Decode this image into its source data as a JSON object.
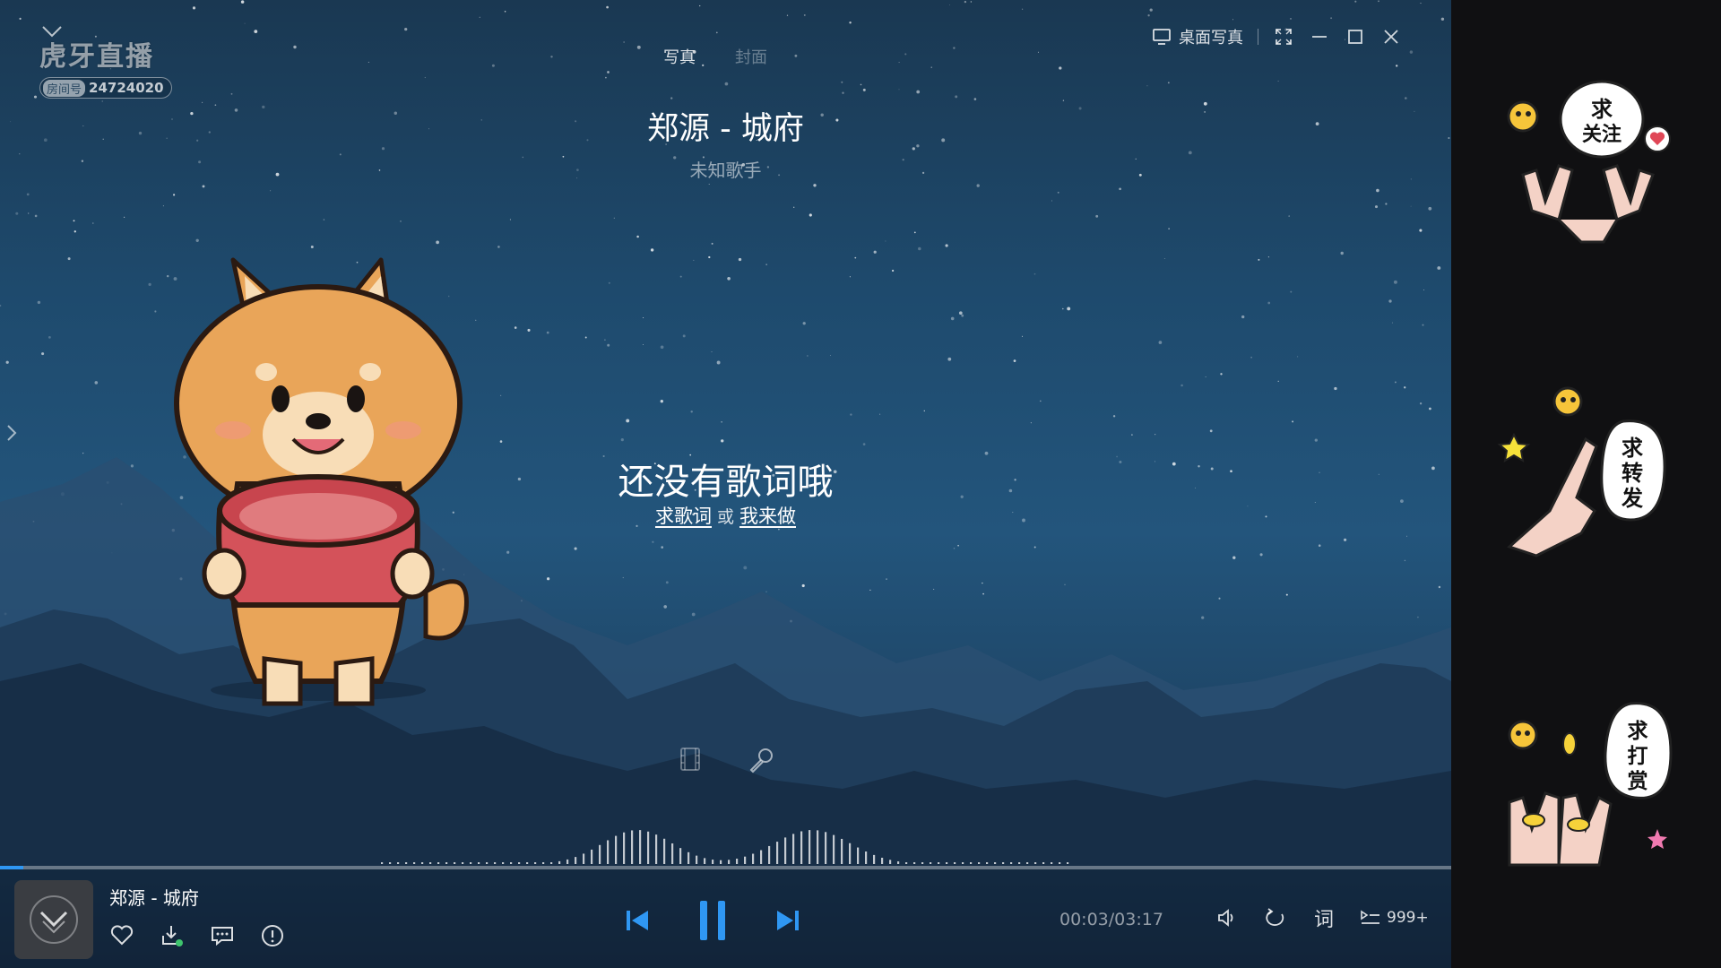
{
  "logo": {
    "brand": "虎牙直播",
    "room_label": "房间号",
    "room_number": "24724020"
  },
  "tabs": [
    {
      "label": "写真",
      "active": true
    },
    {
      "label": "封面",
      "active": false
    }
  ],
  "window": {
    "desktop_photo_label": "桌面写真"
  },
  "song": {
    "title": "郑源 - 城府",
    "artist": "未知歌手"
  },
  "lyrics": {
    "empty_message": "还没有歌词哦",
    "request_link": "求歌词",
    "or_text": "或",
    "make_link": "我来做"
  },
  "player": {
    "now_playing": "郑源 - 城府",
    "time_display": "00:03/03:17",
    "progress_fraction": 0.016,
    "lyric_button": "词",
    "playlist_count": "999+"
  },
  "stickers": [
    {
      "text": "求关注"
    },
    {
      "text": "求转发"
    },
    {
      "text": "求打赏"
    }
  ],
  "colors": {
    "accent": "#2f97f3",
    "sky_top": "#1a3852",
    "sky_mid": "#23557c",
    "sticker_bg": "#101012"
  },
  "icons": [
    "collapse-chevron-icon",
    "desktop-icon",
    "fullscreen-icon",
    "minimize-icon",
    "maximize-icon",
    "close-icon",
    "film-icon",
    "microphone-icon",
    "heart-icon",
    "download-icon",
    "comment-icon",
    "info-icon",
    "prev-icon",
    "pause-icon",
    "next-icon",
    "volume-icon",
    "repeat-icon",
    "playlist-icon"
  ]
}
